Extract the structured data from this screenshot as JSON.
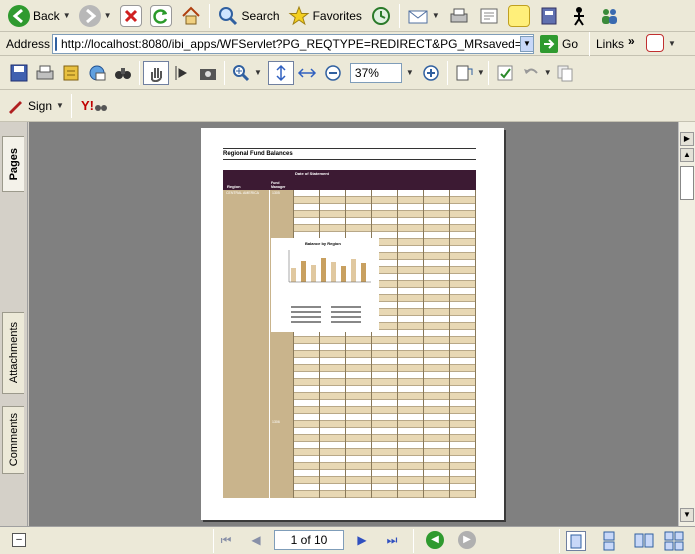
{
  "ie_toolbar": {
    "back_label": "Back",
    "search_label": "Search",
    "favorites_label": "Favorites"
  },
  "address_bar": {
    "label": "Address",
    "url": "http://localhost:8080/ibi_apps/WFServlet?PG_REQTYPE=REDIRECT&PG_MRsaved=false&PG",
    "go_label": "Go",
    "links_label": "Links"
  },
  "acrobat_toolbar": {
    "zoom_value": "37%"
  },
  "acrobat_toolbar2": {
    "sign_label": "Sign"
  },
  "sidebar": {
    "tabs": [
      "Pages",
      "Attachments",
      "Comments"
    ]
  },
  "document": {
    "title": "Regional Fund Balances",
    "header_date": "Date of Statement",
    "col_region": "Region",
    "col_fund": "Fund Manager",
    "region_1": "CENTRAL AMERICA",
    "fund_1": "1305",
    "fund_2": "1306",
    "chart_title": "Balance by Region"
  },
  "status": {
    "page_indicator": "1 of 10"
  },
  "colors": {
    "dark_header": "#3c1a33",
    "tan_column": "#c9b48c",
    "band": "#e8d8b4"
  }
}
